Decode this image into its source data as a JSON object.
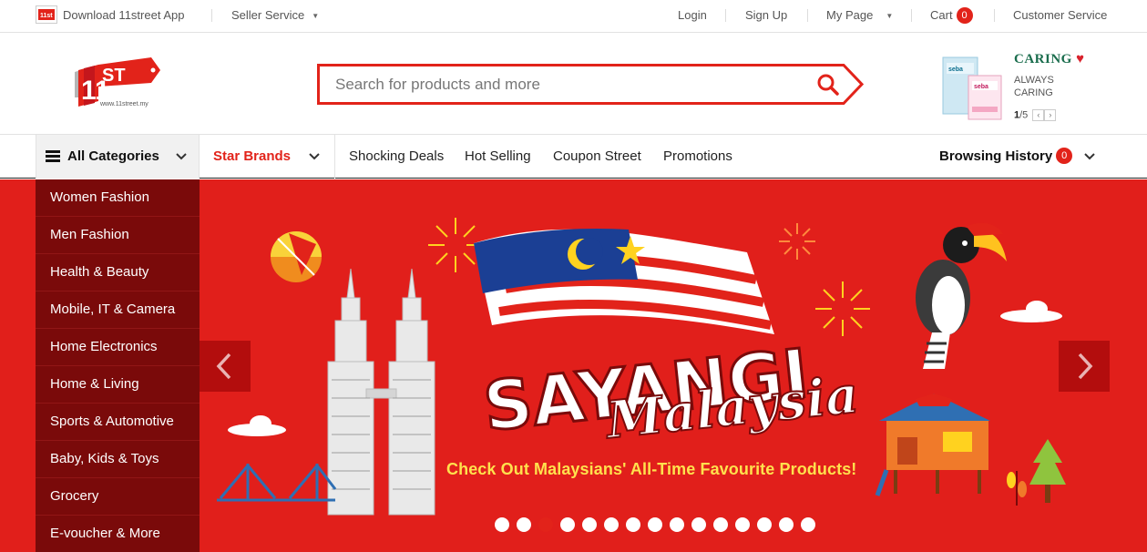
{
  "topbar": {
    "download_app": "Download 11street App",
    "seller_service": "Seller Service",
    "login": "Login",
    "signup": "Sign Up",
    "my_page": "My Page",
    "cart": "Cart",
    "cart_count": "0",
    "customer_service": "Customer Service"
  },
  "header": {
    "logo_text": "11ST",
    "logo_url": "www.11street.my",
    "search_placeholder": "Search for products and more",
    "ad": {
      "brand": "CARING",
      "tagline_1": "ALWAYS",
      "tagline_2": "CARING",
      "page_current": "1",
      "page_total": "/5"
    }
  },
  "nav": {
    "all_categories": "All Categories",
    "star_brands": "Star Brands",
    "links": [
      "Shocking Deals",
      "Hot Selling",
      "Coupon Street",
      "Promotions"
    ],
    "browsing_history": "Browsing History",
    "history_count": "0"
  },
  "categories": [
    "Women Fashion",
    "Men Fashion",
    "Health & Beauty",
    "Mobile, IT & Camera",
    "Home Electronics",
    "Home & Living",
    "Sports & Automotive",
    "Baby, Kids & Toys",
    "Grocery",
    "E-voucher & More"
  ],
  "banner": {
    "headline_1": "SAYANGI",
    "headline_2": "Malaysia",
    "slogan": "Check Out Malaysians' All-Time Favourite Products!",
    "slide_count": 15,
    "active_slide": 3
  },
  "colors": {
    "brand_red": "#e2231a",
    "banner_red": "#e11f1b",
    "menu_dark_red": "#7a0a0a",
    "slogan_yellow": "#ffe14d"
  }
}
